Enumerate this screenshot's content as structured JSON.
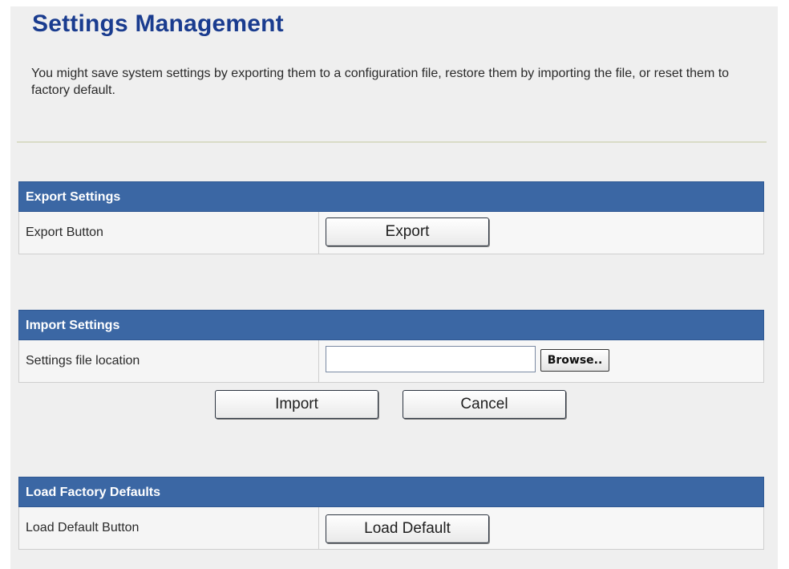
{
  "page": {
    "title": "Settings Management",
    "description": "You might save system settings by exporting them to a configuration file, restore them by importing the file, or reset them to factory default."
  },
  "export": {
    "header": "Export Settings",
    "label": "Export Button",
    "button": "Export"
  },
  "import": {
    "header": "Import Settings",
    "label": "Settings file location",
    "file_value": "",
    "browse": "Browse..",
    "import_button": "Import",
    "cancel_button": "Cancel"
  },
  "factory": {
    "header": "Load Factory Defaults",
    "label": "Load Default Button",
    "button": "Load Default"
  },
  "colors": {
    "title": "#1a3c8f",
    "section_header": "#3b67a4",
    "background": "#efefef"
  }
}
